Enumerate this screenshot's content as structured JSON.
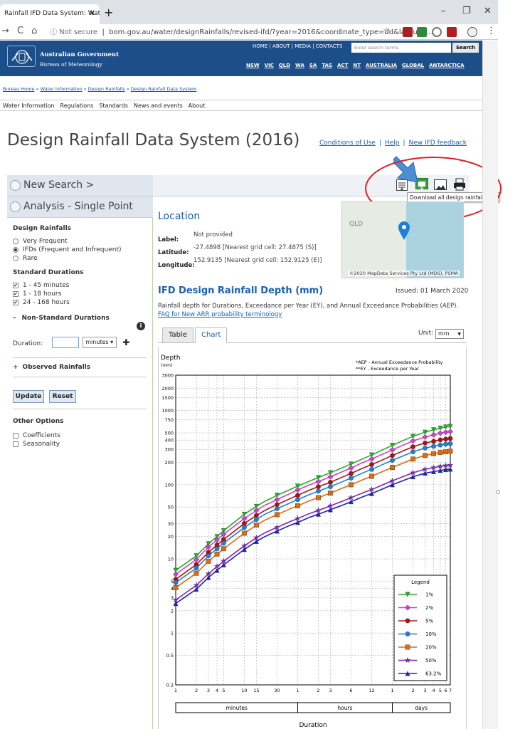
{
  "browser": {
    "tab_title": "Rainfall IFD Data System: Water I",
    "tab_close": "✕",
    "new_tab": "+",
    "minimize": "–",
    "maximize": "❐",
    "close": "✕",
    "back": "←",
    "forward": "→",
    "reload": "C",
    "home": "⌂",
    "not_secure": "ⓘ Not secure",
    "url": "bom.gov.au/water/designRainfalls/revised-ifd/?year=2016&coordinate_type=dd&latitude...",
    "menu": "⋮"
  },
  "site_header": {
    "top_nav": "HOME | ABOUT | MEDIA | CONTACTS",
    "search_placeholder": "Enter search terms",
    "search_button": "Search",
    "gov_name": "Australian Government",
    "agency": "Bureau of Meteorology",
    "states": [
      "NSW",
      "VIC",
      "QLD",
      "WA",
      "SA",
      "TAS",
      "ACT",
      "NT",
      "AUSTRALIA",
      "GLOBAL",
      "ANTARCTICA"
    ]
  },
  "breadcrumb": [
    "Bureau Home",
    "Water Information",
    "Design Rainfalls",
    "Design Rainfall Data System"
  ],
  "breadcrumb_sep": "»",
  "menu": [
    "Water Information",
    "Regulations",
    "Standards",
    "News and events",
    "About"
  ],
  "page": {
    "title": "Design Rainfall Data System (2016)",
    "links": [
      "Conditions of Use",
      "Help",
      "New IFD feedback"
    ],
    "link_sep": "|"
  },
  "sidebar": {
    "new_search": "New Search >",
    "analysis": "Analysis - Single Point",
    "design_rainfalls_label": "Design Rainfalls",
    "rainfall_options": [
      "Very Frequent",
      "IFDs (Frequent and Infrequent)",
      "Rare"
    ],
    "selected_rainfall": 1,
    "standard_durations_label": "Standard Durations",
    "standard_durations": [
      "1 - 45 minutes",
      "1 - 18 hours",
      "24 - 168 hours"
    ],
    "nonstandard_label": "Non-Standard Durations",
    "nonstandard_toggle": "–",
    "info_icon": "i",
    "duration_label": "Duration:",
    "duration_unit": "minutes",
    "add": "✚",
    "observed_label": "Observed Rainfalls",
    "observed_toggle": "+",
    "update": "Update",
    "reset": "Reset",
    "other_options_label": "Other Options",
    "other_options": [
      "Coefficients",
      "Seasonality"
    ],
    "check_mark": "✔"
  },
  "location": {
    "heading": "Location",
    "label_key": "Label:",
    "label_val": "Not provided",
    "lat_key": "Latitude:",
    "lat_val": "-27.4898 [Nearest grid cell: 27.4875 (S)]",
    "lon_key": "Longitude:",
    "lon_val": "152.9135 [Nearest grid cell: 152.9125 (E)]",
    "map_label": "QLD",
    "map_credit": "©2020 MapData Services Pty Ltd (MDS), PSMA"
  },
  "toolbar": {
    "tooltip": "Download all design rainfalls CSV"
  },
  "ifd": {
    "heading": "IFD Design Rainfall Depth (mm)",
    "issued": "Issued: 01 March 2020",
    "description": "Rainfall depth for Durations, Exceedance per Year (EY), and Annual Exceedance Probabilities (AEP).",
    "faq": "FAQ for New ARR probability terminology",
    "tab_table": "Table",
    "tab_chart": "Chart",
    "unit_label": "Unit:",
    "unit_value": "mm",
    "unit_caret": "▼"
  },
  "colors": {
    "brand": "#1c4e8a",
    "link": "#1a5fb4",
    "highlight_red": "#e02020",
    "arrow_blue": "#4a8fd4"
  },
  "chart_data": {
    "type": "line",
    "ylabel": "Depth",
    "yunit": "(mm)",
    "xlabel": "Duration",
    "yscale": "log",
    "ylim": [
      0.2,
      3000
    ],
    "note1": "*AEP - Annual Exceedance Probability",
    "note2": "**EY - Exceedance per Year",
    "legend_title": "Legend",
    "legend_position": "bottom-right",
    "y_ticks": [
      0.2,
      0.5,
      1,
      2,
      3,
      4,
      5,
      10,
      20,
      30,
      50,
      100,
      200,
      300,
      400,
      500,
      750,
      1000,
      1500,
      2000,
      3000
    ],
    "x_ticks": [
      "1",
      "2",
      "3",
      "4",
      "5",
      "10",
      "15",
      "30",
      "1",
      "2",
      "3",
      "6",
      "12",
      "1",
      "2",
      "3",
      "4",
      "5",
      "6",
      "7"
    ],
    "x_groups": [
      "minutes",
      "hours",
      "days"
    ],
    "durations_min": [
      1,
      2,
      3,
      4,
      5,
      10,
      15,
      20,
      25,
      30,
      45,
      60,
      90,
      120,
      180,
      270,
      360,
      540,
      720,
      1080,
      1440,
      2880,
      4320,
      5760,
      7200,
      8640,
      10080
    ],
    "series": [
      {
        "name": "1%",
        "color": "#22b222",
        "marker": "tri-down",
        "values": [
          7,
          11,
          16,
          20,
          24,
          40,
          51,
          60,
          66,
          72,
          85,
          96,
          112,
          125,
          145,
          170,
          190,
          225,
          252,
          300,
          340,
          450,
          510,
          550,
          580,
          600,
          610
        ]
      },
      {
        "name": "2%",
        "color": "#d040d0",
        "marker": "diamond",
        "values": [
          6.2,
          9.8,
          14.5,
          18,
          21.5,
          35,
          45,
          53,
          58,
          63,
          75,
          85,
          100,
          110,
          128,
          150,
          168,
          200,
          222,
          262,
          295,
          390,
          440,
          470,
          495,
          510,
          520
        ]
      },
      {
        "name": "5%",
        "color": "#b01010",
        "marker": "circle",
        "values": [
          5.3,
          8.4,
          12.3,
          15.4,
          18.3,
          30,
          38.5,
          45,
          50,
          54,
          64,
          72,
          85,
          94,
          108,
          127,
          142,
          168,
          187,
          220,
          248,
          325,
          365,
          385,
          402,
          412,
          420
        ]
      },
      {
        "name": "10%",
        "color": "#1f7fd6",
        "marker": "circle",
        "values": [
          4.8,
          7.5,
          11,
          13.7,
          16.3,
          26.5,
          34,
          40,
          44,
          47.5,
          56,
          63,
          74,
          82,
          94,
          110,
          123,
          145,
          161,
          190,
          213,
          278,
          312,
          330,
          343,
          352,
          358
        ]
      },
      {
        "name": "20%",
        "color": "#e06a10",
        "marker": "square",
        "values": [
          4.1,
          6.4,
          9.3,
          11.6,
          13.7,
          22.2,
          28.5,
          33.4,
          36.6,
          39.5,
          46.7,
          52,
          61,
          67,
          77,
          90,
          100,
          117,
          130,
          153,
          171,
          222,
          248,
          262,
          272,
          278,
          283
        ]
      },
      {
        "name": "50%",
        "color": "#8a20c8",
        "marker": "star",
        "values": [
          2.8,
          4.4,
          6.3,
          7.9,
          9.3,
          15,
          19.3,
          22.5,
          24.7,
          26.6,
          31.4,
          35,
          41,
          45,
          52,
          60,
          67,
          78,
          86,
          101,
          113,
          145,
          162,
          170,
          177,
          181,
          184
        ]
      },
      {
        "name": "63.2%",
        "color": "#1e22b8",
        "marker": "tri-up",
        "values": [
          2.5,
          3.9,
          5.6,
          7,
          8.3,
          13.4,
          17.2,
          20,
          22,
          23.7,
          28,
          31,
          36.5,
          40,
          46,
          53,
          59,
          69,
          76,
          89,
          100,
          128,
          143,
          150,
          156,
          160,
          162
        ]
      }
    ]
  }
}
